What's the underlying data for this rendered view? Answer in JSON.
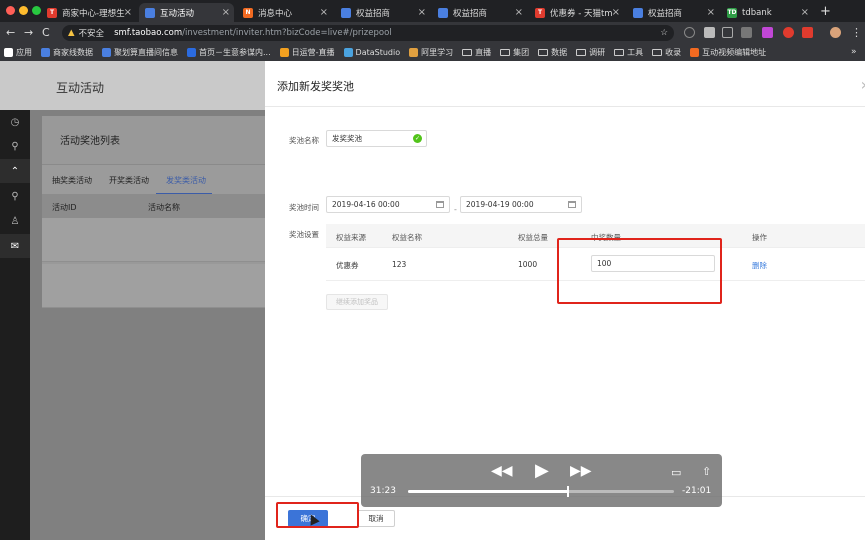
{
  "browser": {
    "tabs": [
      {
        "title": "商家中心-理想生",
        "color": "#e03b2e",
        "glyph": "T"
      },
      {
        "title": "互动活动",
        "color": "#4a7fe0",
        "glyph": "",
        "active": true
      },
      {
        "title": "消息中心",
        "color": "#f26a21",
        "glyph": "N"
      },
      {
        "title": "权益招商",
        "color": "#4a7fe0",
        "glyph": ""
      },
      {
        "title": "权益招商",
        "color": "#4a7fe0",
        "glyph": ""
      },
      {
        "title": "优惠券 - 天猫tm",
        "color": "#e03b2e",
        "glyph": "T"
      },
      {
        "title": "权益招商",
        "color": "#4a7fe0",
        "glyph": ""
      },
      {
        "title": "tdbank",
        "color": "#2e9d46",
        "glyph": "TD"
      }
    ],
    "address": {
      "warning": "不安全",
      "host": "smf.taobao.com",
      "path": "/investment/inviter.htm?bizCode=live#/prizepool"
    },
    "bookmarks": [
      {
        "label": "应用",
        "color": "#ffffff"
      },
      {
        "label": "商家线数据",
        "color": "#4a7fe0"
      },
      {
        "label": "聚划算直播间信息",
        "color": "#4a7fe0"
      },
      {
        "label": "首页－生意参谋内...",
        "color": "#2b6be0"
      },
      {
        "label": "日运营-直播",
        "color": "#f2a020"
      },
      {
        "label": "DataStudio",
        "color": "#4aa3e0"
      },
      {
        "label": "阿里学习",
        "color": "#e0a040"
      },
      {
        "label": "直播",
        "folder": true
      },
      {
        "label": "集团",
        "folder": true
      },
      {
        "label": "数据",
        "folder": true
      },
      {
        "label": "调研",
        "folder": true
      },
      {
        "label": "工具",
        "folder": true
      },
      {
        "label": "收录",
        "folder": true
      },
      {
        "label": "互动视频编辑地址",
        "color": "#f26a21"
      }
    ]
  },
  "app": {
    "title": "互动活动",
    "card_title": "活动奖池列表",
    "subtabs": [
      "抽奖类活动",
      "开奖类活动",
      "发奖类活动"
    ],
    "table_headers": [
      "活动ID",
      "活动名称"
    ]
  },
  "drawer": {
    "title": "添加新发奖奖池",
    "name_label": "奖池名称",
    "name_value": "发奖奖池",
    "time_label": "奖池时间",
    "start_date": "2019-04-16 00:00",
    "end_date": "2019-04-19 00:00",
    "range_separator": "-",
    "setting_label": "奖池设置",
    "columns": [
      "权益来源",
      "权益名称",
      "权益总量",
      "中奖数量",
      "操作"
    ],
    "rows": [
      {
        "source": "优惠券",
        "name": "123",
        "total": "1000",
        "quantity": "100",
        "action": "删除"
      }
    ],
    "add_button": "继续添加奖品",
    "confirm_button": "确定",
    "cancel_button": "取消"
  },
  "video": {
    "elapsed": "31:23",
    "remaining": "-21:01",
    "progress": 0.6
  },
  "colors": {
    "accent": "#3b74d8",
    "highlight": "#e0241b",
    "success": "#52c41a"
  }
}
